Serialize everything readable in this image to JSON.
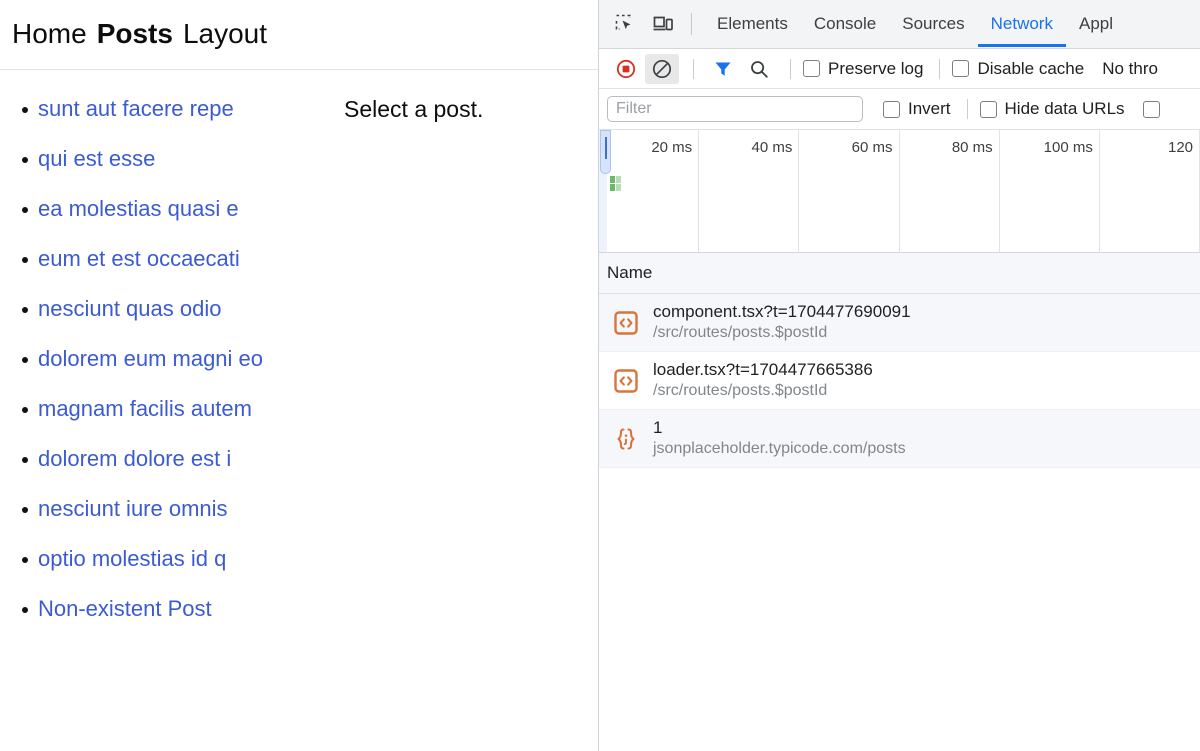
{
  "page": {
    "nav": [
      {
        "label": "Home",
        "active": false
      },
      {
        "label": "Posts",
        "active": true
      },
      {
        "label": "Layout",
        "active": false
      }
    ],
    "posts": [
      "sunt aut facere repe",
      "qui est esse",
      "ea molestias quasi e",
      "eum et est occaecati",
      "nesciunt quas odio",
      "dolorem eum magni eo",
      "magnam facilis autem",
      "dolorem dolore est i",
      "nesciunt iure omnis",
      "optio molestias id q",
      "Non-existent Post"
    ],
    "detail_message": "Select a post.",
    "link_color": "#3b5bd4"
  },
  "devtools": {
    "icons": {
      "inspect": "inspect-element-icon",
      "device": "device-toolbar-icon"
    },
    "tabs": [
      {
        "label": "Elements",
        "active": false
      },
      {
        "label": "Console",
        "active": false
      },
      {
        "label": "Sources",
        "active": false
      },
      {
        "label": "Network",
        "active": true
      },
      {
        "label": "Appl",
        "active": false
      }
    ],
    "toolbar": {
      "record_icon": "record-stop-icon",
      "clear_icon": "clear-network-log-icon",
      "filter_icon": "filter-funnel-icon",
      "search_icon": "search-icon",
      "preserve_log_label": "Preserve log",
      "disable_cache_label": "Disable cache",
      "throttle_label": "No thro",
      "accent_color": "#1a73e8",
      "record_color": "#d93025"
    },
    "filterbar": {
      "filter_placeholder": "Filter",
      "filter_value": "",
      "invert_label": "Invert",
      "hide_data_urls_label": "Hide data URLs"
    },
    "overview": {
      "ticks": [
        "20 ms",
        "40 ms",
        "60 ms",
        "80 ms",
        "100 ms",
        "120"
      ]
    },
    "table": {
      "columns": [
        "Name"
      ],
      "rows": [
        {
          "icon": "js-file-icon",
          "name": "component.tsx?t=1704477690091",
          "path": "/src/routes/posts.$postId"
        },
        {
          "icon": "js-file-icon",
          "name": "loader.tsx?t=1704477665386",
          "path": "/src/routes/posts.$postId"
        },
        {
          "icon": "json-file-icon",
          "name": "1",
          "path": "jsonplaceholder.typicode.com/posts"
        }
      ]
    }
  }
}
